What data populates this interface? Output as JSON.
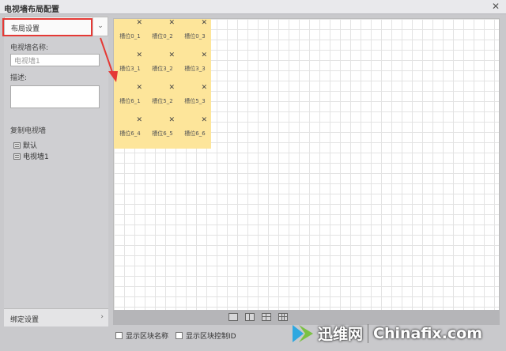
{
  "window": {
    "title": "电视墙布局配置"
  },
  "sidebar": {
    "dropdown_label": "布局设置",
    "name_label": "电视墙名称:",
    "name_value": "电视墙1",
    "desc_label": "描述:",
    "copy_title": "复制电视墙",
    "tree_items": [
      "默认",
      "电视墙1"
    ],
    "bind_settings_label": "绑定设置"
  },
  "canvas": {
    "blocks": [
      [
        "槽位0_1",
        "槽位0_2",
        "槽位0_3"
      ],
      [
        "槽位3_1",
        "槽位3_2",
        "槽位3_3"
      ],
      [
        "槽位6_1",
        "槽位5_2",
        "槽位5_3"
      ],
      [
        "槽位6_4",
        "槽位6_5",
        "槽位6_6"
      ]
    ]
  },
  "options": {
    "show_block_name": "显示区块名称",
    "show_block_control_id": "显示区块控制ID"
  },
  "watermark": {
    "cn": "迅维网",
    "en": "Chinafix.com"
  },
  "colors": {
    "block": "#fde59a",
    "highlight": "#e53935"
  }
}
